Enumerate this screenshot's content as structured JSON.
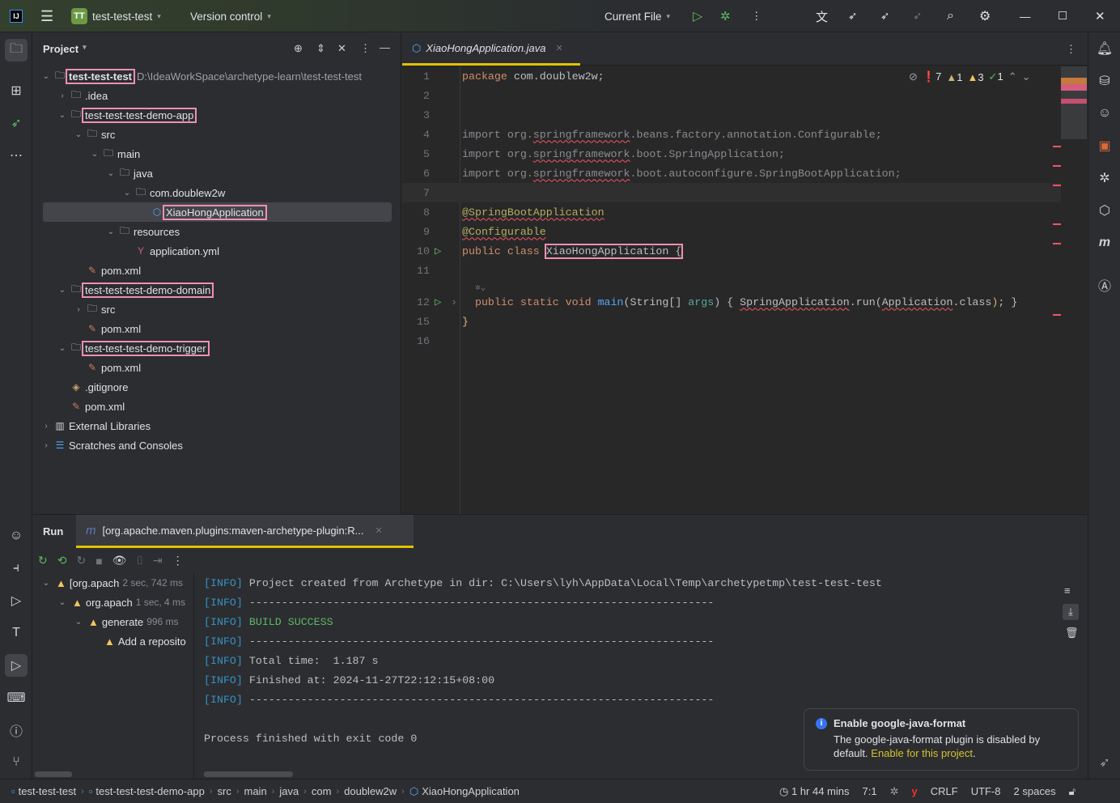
{
  "titlebar": {
    "logo": "IJ",
    "project_badge": "TT",
    "project_name": "test-test-test",
    "vcs": "Version control",
    "run_config": "Current File"
  },
  "project_panel": {
    "title": "Project",
    "root_path": "D:\\IdeaWorkSpace\\archetype-learn\\test-test-test",
    "tree": [
      {
        "label": "test-test-test",
        "level": 0,
        "chevron": "down",
        "icon": "folder",
        "boxed": true,
        "bold": true
      },
      {
        "label": ".idea",
        "level": 1,
        "chevron": "right",
        "icon": "folder"
      },
      {
        "label": "test-test-test-demo-app",
        "level": 1,
        "chevron": "down",
        "icon": "folder",
        "boxed": true
      },
      {
        "label": "src",
        "level": 2,
        "chevron": "down",
        "icon": "folder"
      },
      {
        "label": "main",
        "level": 3,
        "chevron": "down",
        "icon": "folder"
      },
      {
        "label": "java",
        "level": 4,
        "chevron": "down",
        "icon": "folder"
      },
      {
        "label": "com.doublew2w",
        "level": 5,
        "chevron": "down",
        "icon": "folder"
      },
      {
        "label": "XiaoHongApplication",
        "level": 6,
        "chevron": "",
        "icon": "class",
        "boxed": true,
        "selected": true
      },
      {
        "label": "resources",
        "level": 4,
        "chevron": "down",
        "icon": "folder"
      },
      {
        "label": "application.yml",
        "level": 5,
        "chevron": "",
        "icon": "yaml"
      },
      {
        "label": "pom.xml",
        "level": 2,
        "chevron": "",
        "icon": "maven"
      },
      {
        "label": "test-test-test-demo-domain",
        "level": 1,
        "chevron": "down",
        "icon": "folder",
        "boxed": true
      },
      {
        "label": "src",
        "level": 2,
        "chevron": "right",
        "icon": "folder"
      },
      {
        "label": "pom.xml",
        "level": 2,
        "chevron": "",
        "icon": "maven"
      },
      {
        "label": "test-test-test-demo-trigger",
        "level": 1,
        "chevron": "down",
        "icon": "folder",
        "boxed": true
      },
      {
        "label": "pom.xml",
        "level": 2,
        "chevron": "",
        "icon": "maven"
      },
      {
        "label": ".gitignore",
        "level": 1,
        "chevron": "",
        "icon": "gitignore"
      },
      {
        "label": "pom.xml",
        "level": 1,
        "chevron": "",
        "icon": "maven"
      },
      {
        "label": "External Libraries",
        "level": 0,
        "chevron": "right",
        "icon": "library"
      },
      {
        "label": "Scratches and Consoles",
        "level": 0,
        "chevron": "right",
        "icon": "scratches"
      }
    ]
  },
  "editor": {
    "tab": "XiaoHongApplication.java",
    "inspections": {
      "errors": "7",
      "weak_warnings": "1",
      "warnings": "3",
      "ok": "1"
    },
    "lines": [
      {
        "n": "1",
        "tokens": [
          [
            "kw",
            "package"
          ],
          [
            "pl",
            " com.doublew2w;"
          ]
        ]
      },
      {
        "n": "2",
        "tokens": []
      },
      {
        "n": "3",
        "tokens": []
      },
      {
        "n": "4",
        "tokens": [
          [
            "gray",
            "import org."
          ],
          [
            "gray wavy",
            "springframework"
          ],
          [
            "gray",
            ".beans.factory.annotation.Configurable;"
          ]
        ]
      },
      {
        "n": "5",
        "tokens": [
          [
            "gray",
            "import org."
          ],
          [
            "gray wavy",
            "springframework"
          ],
          [
            "gray",
            ".boot.SpringApplication;"
          ]
        ]
      },
      {
        "n": "6",
        "tokens": [
          [
            "gray",
            "import org."
          ],
          [
            "gray wavy",
            "springframework"
          ],
          [
            "gray",
            ".boot.autoconfigure.SpringBootApplication;"
          ]
        ]
      },
      {
        "n": "7",
        "tokens": [],
        "current": true
      },
      {
        "n": "8",
        "tokens": [
          [
            "ann wavy",
            "@SpringBootApplication"
          ]
        ]
      },
      {
        "n": "9",
        "tokens": [
          [
            "ann wavy",
            "@Configurable"
          ]
        ]
      },
      {
        "n": "10",
        "tokens": [
          [
            "kw",
            "public class "
          ],
          [
            "pl boxed",
            "XiaoHongApplication {"
          ]
        ],
        "run": true
      },
      {
        "n": "11",
        "tokens": []
      },
      {
        "n": "12",
        "tokens": [
          [
            "kw",
            "  public static void "
          ],
          [
            "fn",
            "main"
          ],
          [
            "pl",
            "(String[] "
          ],
          [
            "arg",
            "args"
          ],
          [
            "pl",
            ") { "
          ],
          [
            "pl wavy",
            "SpringApplication"
          ],
          [
            "pl",
            ".run("
          ],
          [
            "pl wavy",
            "Application"
          ],
          [
            "pl",
            ".class"
          ],
          [
            "kw2",
            ")"
          ],
          [
            "pl",
            "; }"
          ]
        ],
        "run": true,
        "folded": true
      },
      {
        "n": "15",
        "tokens": [
          [
            "kw2",
            "}"
          ]
        ]
      },
      {
        "n": "16",
        "tokens": []
      }
    ]
  },
  "run_panel": {
    "title": "Run",
    "tab": "[org.apache.maven.plugins:maven-archetype-plugin:R...",
    "tree": [
      {
        "label": "[org.apach",
        "time": "2 sec, 742 ms",
        "level": 0
      },
      {
        "label": "org.apach",
        "time": "1 sec, 4 ms",
        "level": 1
      },
      {
        "label": "generate",
        "time": "996 ms",
        "level": 2
      },
      {
        "label": "Add a reposito",
        "time": "",
        "level": 3
      }
    ],
    "console": [
      {
        "tag": "[INFO]",
        "text": " Project created from Archetype in dir: C:\\Users\\lyh\\AppData\\Local\\Temp\\archetypetmp\\test-test-test"
      },
      {
        "tag": "[INFO]",
        "text": " ------------------------------------------------------------------------"
      },
      {
        "tag": "[INFO]",
        "text": " BUILD SUCCESS",
        "success": true
      },
      {
        "tag": "[INFO]",
        "text": " ------------------------------------------------------------------------"
      },
      {
        "tag": "[INFO]",
        "text": " Total time:  1.187 s"
      },
      {
        "tag": "[INFO]",
        "text": " Finished at: 2024-11-27T22:12:15+08:00"
      },
      {
        "tag": "[INFO]",
        "text": " ------------------------------------------------------------------------"
      },
      {
        "tag": "",
        "text": ""
      },
      {
        "tag": "",
        "text": "Process finished with exit code 0"
      }
    ]
  },
  "notification": {
    "title": "Enable google-java-format",
    "body": "The google-java-format plugin is disabled by default.",
    "link": "Enable for this project",
    "end": "."
  },
  "statusbar": {
    "breadcrumbs": [
      "test-test-test",
      "test-test-test-demo-app",
      "src",
      "main",
      "java",
      "com",
      "doublew2w",
      "XiaoHongApplication"
    ],
    "time_tracker": "1 hr 44 mins",
    "position": "7:1",
    "line_ending": "CRLF",
    "encoding": "UTF-8",
    "indent": "2 spaces"
  },
  "colors": {
    "accent": "#3574f0",
    "highlight_box": "#f08fb4",
    "run_tab_underline": "#e0c200",
    "error": "#f75464",
    "warning": "#f2c55c",
    "success": "#5fb865"
  }
}
